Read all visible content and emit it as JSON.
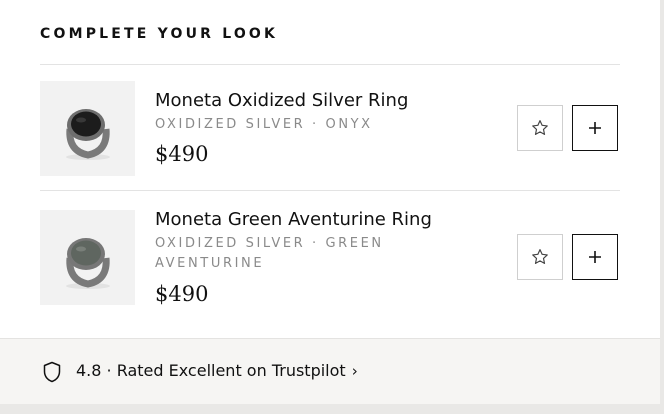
{
  "section": {
    "title": "COMPLETE YOUR LOOK"
  },
  "items": [
    {
      "name": "Moneta Oxidized Silver Ring",
      "variant": "OXIDIZED SILVER · ONYX",
      "price": "$490",
      "stone_color": "#1c1c1c",
      "wishlist_icon": "star-outline-icon",
      "add_icon": "plus-icon"
    },
    {
      "name": "Moneta Green Aventurine Ring",
      "variant": "OXIDIZED SILVER · GREEN AVENTURINE",
      "price": "$490",
      "stone_color": "#5f6660",
      "wishlist_icon": "star-outline-icon",
      "add_icon": "plus-icon"
    }
  ],
  "trust": {
    "icon": "shield-icon",
    "text": "4.8 · Rated Excellent on Trustpilot",
    "chevron": "›"
  },
  "colors": {
    "background": "#ffffff",
    "trust_background": "#f6f5f3",
    "muted_text": "#8a8a8a",
    "thumb_background": "#f2f2f2"
  }
}
